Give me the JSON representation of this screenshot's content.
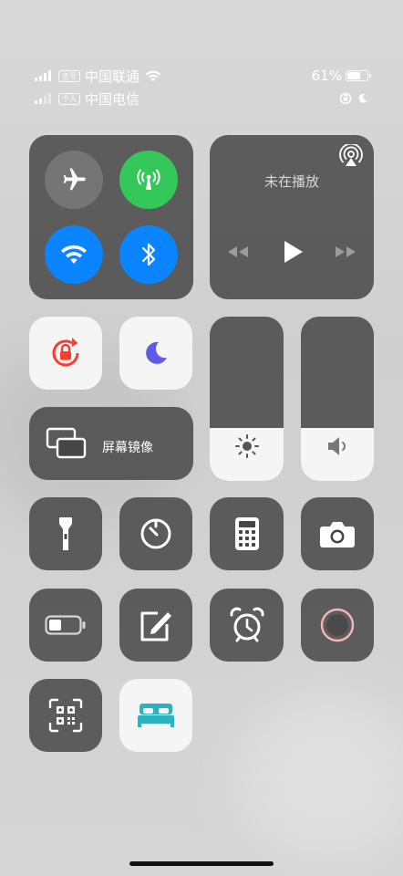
{
  "status": {
    "carrier1": "中国联通",
    "sim1_tag": "主号",
    "carrier2": "中国电信",
    "sim2_tag": "个人",
    "battery_text": "61%",
    "battery_level": 0.61
  },
  "now_playing": {
    "title": "未在播放"
  },
  "screen_mirroring": {
    "label": "屏幕镜像"
  },
  "sliders": {
    "brightness_level": 0.32,
    "volume_level": 0.32
  },
  "icons": {
    "airplane": "airplane-icon",
    "cellular": "antenna-icon",
    "wifi": "wifi-icon",
    "bluetooth": "bluetooth-icon",
    "airplay": "airplay-icon",
    "rotation_lock": "rotation-lock-icon",
    "do_not_disturb": "moon-icon",
    "flashlight": "flashlight-icon",
    "timer": "timer-icon",
    "calculator": "calculator-icon",
    "camera": "camera-icon",
    "low_power": "battery-icon",
    "notes": "note-icon",
    "alarm": "alarm-icon",
    "screen_record": "record-icon",
    "qr_scanner": "qr-code-icon",
    "sleep": "bed-icon"
  },
  "colors": {
    "green": "#34c759",
    "blue": "#0a84ff",
    "red": "#ff3b30",
    "purple": "#5e5ce6",
    "teal": "#2bb3c0"
  }
}
